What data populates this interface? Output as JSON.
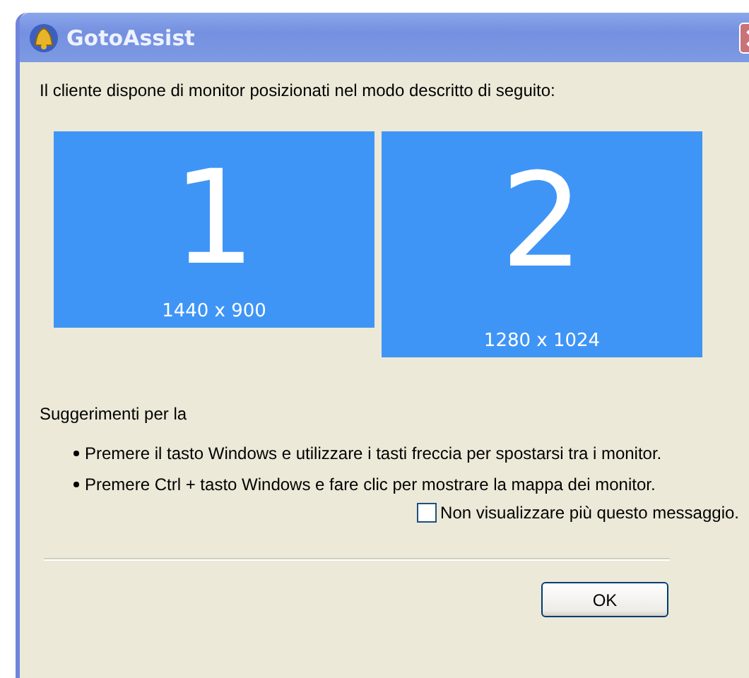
{
  "window": {
    "title": "GotoAssist"
  },
  "intro": "Il cliente dispone di monitor posizionati nel modo descritto di seguito:",
  "monitors": [
    {
      "number": "1",
      "resolution": "1440 x 900"
    },
    {
      "number": "2",
      "resolution": "1280 x 1024"
    }
  ],
  "tips_heading": "Suggerimenti per la",
  "tips": [
    "Premere il tasto Windows e utilizzare i tasti freccia per spostarsi tra i monitor.",
    "Premere Ctrl + tasto Windows e fare clic per mostrare la mappa dei monitor."
  ],
  "dont_show": {
    "label": "Non visualizzare più questo messaggio.",
    "checked": false
  },
  "buttons": [
    "OK"
  ]
}
